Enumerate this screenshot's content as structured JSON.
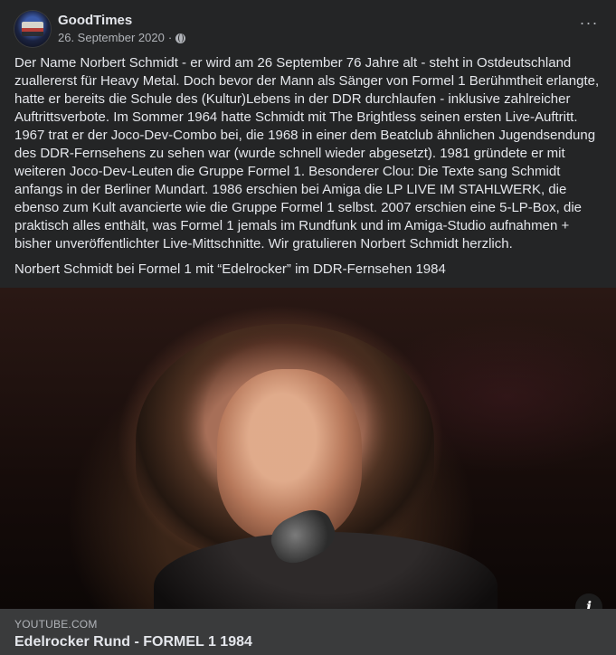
{
  "post": {
    "page_name": "GoodTimes",
    "date": "26. September 2020",
    "meta_separator": "·",
    "more_label": "···",
    "paragraphs": [
      "Der Name Norbert Schmidt - er wird am 26 September 76 Jahre alt - steht in Ostdeutschland zuallererst für Heavy Metal. Doch bevor der Mann als Sänger von Formel 1 Berühmtheit erlangte, hatte er bereits die Schule des (Kultur)Lebens in der DDR durchlaufen - inklusive zahlreicher Auftrittsverbote. Im Sommer 1964 hatte Schmidt mit The Brightless seinen ersten Live-Auftritt. 1967 trat er der Joco-Dev-Combo bei, die 1968 in einer dem Beatclub ähnlichen Jugendsendung des DDR-Fernsehens zu sehen war (wurde schnell wieder abgesetzt). 1981 gründete er mit weiteren Joco-Dev-Leuten die Gruppe Formel 1. Besonderer Clou: Die Texte sang Schmidt anfangs in der Berliner Mundart. 1986 erschien bei Amiga die LP LIVE IM STAHLWERK, die ebenso zum Kult avancierte wie die Gruppe Formel 1 selbst. 2007 erschien eine 5-LP-Box, die praktisch alles enthält, was Formel 1 jemals im Rundfunk und im Amiga-Studio aufnahmen + bisher unveröffentlichter Live-Mittschnitte. Wir gratulieren Norbert Schmidt herzlich.",
      "Norbert Schmidt bei Formel 1 mit “Edelrocker” im DDR-Fernsehen 1984"
    ]
  },
  "media": {
    "info_label": "i"
  },
  "link": {
    "domain": "YOUTUBE.COM",
    "title": "Edelrocker Rund - FORMEL 1 1984"
  },
  "colors": {
    "card_bg": "#242526",
    "footer_bg": "#3a3b3c",
    "primary_text": "#e4e6eb",
    "secondary_text": "#b0b3b8"
  },
  "icons": [
    "page-avatar",
    "globe-icon",
    "more-options-icon",
    "info-icon"
  ]
}
